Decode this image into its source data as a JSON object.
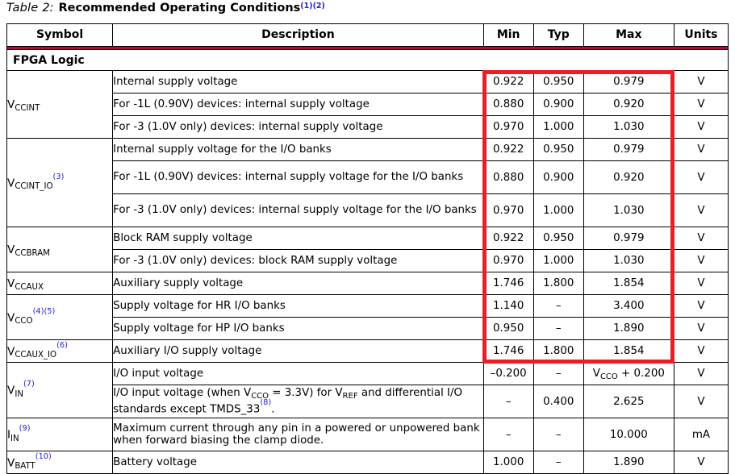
{
  "caption": {
    "label": "Table",
    "number": "2:",
    "title": "Recommended Operating Conditions",
    "footnote_refs": "(1)(2)"
  },
  "colors": {
    "header_rule": "#ab0f35",
    "highlight_box": "#ee1c25",
    "footnote_ref": "#2222cc",
    "grid": "#000000"
  },
  "table": {
    "columns": [
      {
        "key": "symbol",
        "label": "Symbol"
      },
      {
        "key": "description",
        "label": "Description"
      },
      {
        "key": "min",
        "label": "Min"
      },
      {
        "key": "typ",
        "label": "Typ"
      },
      {
        "key": "max",
        "label": "Max"
      },
      {
        "key": "units",
        "label": "Units"
      }
    ],
    "sections": [
      {
        "label": "FPGA Logic"
      }
    ],
    "rows": [
      {
        "symbol_base": "V",
        "symbol_sub": "CCINT",
        "symbol_note": "",
        "description": "Internal supply voltage",
        "min": "0.922",
        "typ": "0.950",
        "max": "0.979",
        "units": "V"
      },
      {
        "symbol_base": "",
        "symbol_sub": "",
        "symbol_note": "",
        "description": "For -1L (0.90V) devices: internal supply voltage",
        "min": "0.880",
        "typ": "0.900",
        "max": "0.920",
        "units": "V"
      },
      {
        "symbol_base": "",
        "symbol_sub": "",
        "symbol_note": "",
        "description": "For -3 (1.0V only) devices: internal supply voltage",
        "min": "0.970",
        "typ": "1.000",
        "max": "1.030",
        "units": "V"
      },
      {
        "symbol_base": "V",
        "symbol_sub": "CCINT_IO",
        "symbol_note": "(3)",
        "description": "Internal supply voltage for the I/O banks",
        "min": "0.922",
        "typ": "0.950",
        "max": "0.979",
        "units": "V"
      },
      {
        "symbol_base": "",
        "symbol_sub": "",
        "symbol_note": "",
        "description": "For -1L (0.90V) devices: internal supply voltage for the I/O banks",
        "min": "0.880",
        "typ": "0.900",
        "max": "0.920",
        "units": "V"
      },
      {
        "symbol_base": "",
        "symbol_sub": "",
        "symbol_note": "",
        "description": "For -3 (1.0V only) devices: internal supply voltage for the I/O banks",
        "min": "0.970",
        "typ": "1.000",
        "max": "1.030",
        "units": "V"
      },
      {
        "symbol_base": "V",
        "symbol_sub": "CCBRAM",
        "symbol_note": "",
        "description": "Block RAM supply voltage",
        "min": "0.922",
        "typ": "0.950",
        "max": "0.979",
        "units": "V"
      },
      {
        "symbol_base": "",
        "symbol_sub": "",
        "symbol_note": "",
        "description": "For -3 (1.0V only) devices: block RAM supply voltage",
        "min": "0.970",
        "typ": "1.000",
        "max": "1.030",
        "units": "V"
      },
      {
        "symbol_base": "V",
        "symbol_sub": "CCAUX",
        "symbol_note": "",
        "description": "Auxiliary supply voltage",
        "min": "1.746",
        "typ": "1.800",
        "max": "1.854",
        "units": "V"
      },
      {
        "symbol_base": "V",
        "symbol_sub": "CCO",
        "symbol_note": "(4)(5)",
        "description": "Supply voltage for HR I/O banks",
        "min": "1.140",
        "typ": "–",
        "max": "3.400",
        "units": "V"
      },
      {
        "symbol_base": "",
        "symbol_sub": "",
        "symbol_note": "",
        "description": "Supply voltage for HP I/O banks",
        "min": "0.950",
        "typ": "–",
        "max": "1.890",
        "units": "V"
      },
      {
        "symbol_base": "V",
        "symbol_sub": "CCAUX_IO",
        "symbol_note": "(6)",
        "description": "Auxiliary I/O supply voltage",
        "min": "1.746",
        "typ": "1.800",
        "max": "1.854",
        "units": "V"
      },
      {
        "symbol_base": "V",
        "symbol_sub": "IN",
        "symbol_note": "(7)",
        "description": "I/O input voltage",
        "min": "–0.200",
        "typ": "–",
        "max_base": "V",
        "max_sub": "CCO",
        "max_tail": " + 0.200",
        "units": "V"
      },
      {
        "symbol_base": "",
        "symbol_sub": "",
        "symbol_note": "",
        "description_pre": "I/O input voltage (when V",
        "description_sub1": "CCO",
        "description_mid": " = 3.3V) for V",
        "description_sub2": "REF",
        "description_post": " and differential I/O standards except TMDS_33",
        "description_note": "(8)",
        "description_end": ".",
        "min": "–",
        "typ": "0.400",
        "max": "2.625",
        "units": "V"
      },
      {
        "symbol_base": "I",
        "symbol_sub": "IN",
        "symbol_note": "(9)",
        "description": "Maximum current through any pin in a powered or unpowered bank when forward biasing the clamp diode.",
        "min": "–",
        "typ": "–",
        "max": "10.000",
        "units": "mA"
      },
      {
        "symbol_base": "V",
        "symbol_sub": "BATT",
        "symbol_note": "(10)",
        "description": "Battery voltage",
        "min": "1.000",
        "typ": "–",
        "max": "1.890",
        "units": "V"
      }
    ]
  }
}
